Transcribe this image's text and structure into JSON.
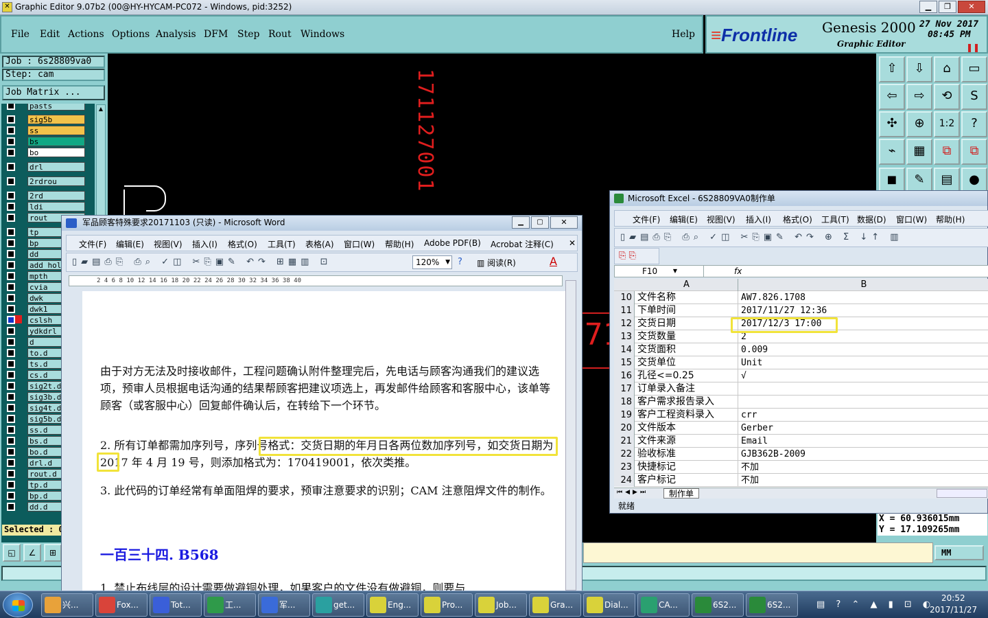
{
  "app": {
    "title": "Graphic Editor 9.07b2 (00@HY-HYCAM-PC072 - Windows, pid:3252)"
  },
  "menu": [
    "File",
    "Edit",
    "Actions",
    "Options",
    "Analysis",
    "DFM",
    "Step",
    "Rout",
    "Windows"
  ],
  "help_label": "Help",
  "brand": {
    "logo": "Frontline",
    "product": "Genesis 2000",
    "subtitle": "Graphic Editor",
    "date": "27 Nov 2017",
    "time": "08:45 PM"
  },
  "job": {
    "job_label": "Job  : 6s28809va0",
    "step_label": "Step: cam",
    "matrix_button": "Job Matrix ..."
  },
  "layers": [
    {
      "name": "pasts",
      "color": "#a8dcdc"
    },
    {
      "name": "sig5b",
      "color": "#f2c24a"
    },
    {
      "name": "ss",
      "color": "#f2c24a"
    },
    {
      "name": "bs",
      "color": "#11a884"
    },
    {
      "name": "bo",
      "color": "#ffffff"
    },
    {
      "name": "drl",
      "color": "#a8dcdc"
    },
    {
      "name": "2rdrou",
      "color": "#a8dcdc"
    },
    {
      "name": "2rd",
      "color": "#a8dcdc"
    },
    {
      "name": "ldi",
      "color": "#a8dcdc"
    },
    {
      "name": "rout",
      "color": "#a8dcdc"
    },
    {
      "name": "tp",
      "color": "#a8dcdc"
    },
    {
      "name": "bp",
      "color": "#a8dcdc"
    },
    {
      "name": "dd",
      "color": "#a8dcdc"
    },
    {
      "name": "add_hol",
      "color": "#a8dcdc"
    },
    {
      "name": "mpth",
      "color": "#a8dcdc"
    },
    {
      "name": "cvia",
      "color": "#a8dcdc"
    },
    {
      "name": "dwk",
      "color": "#a8dcdc"
    },
    {
      "name": "dwk1",
      "color": "#a8dcdc"
    },
    {
      "name": "cslsh",
      "color": "#a8dcdc"
    },
    {
      "name": "ydkdrl",
      "color": "#a8dcdc"
    },
    {
      "name": "d",
      "color": "#a8dcdc"
    },
    {
      "name": "to.d",
      "color": "#a8dcdc"
    },
    {
      "name": "ts.d",
      "color": "#a8dcdc"
    },
    {
      "name": "cs.d",
      "color": "#a8dcdc"
    },
    {
      "name": "sig2t.d",
      "color": "#a8dcdc"
    },
    {
      "name": "sig3b.d",
      "color": "#a8dcdc"
    },
    {
      "name": "sig4t.d",
      "color": "#a8dcdc"
    },
    {
      "name": "sig5b.d",
      "color": "#a8dcdc"
    },
    {
      "name": "ss.d",
      "color": "#a8dcdc"
    },
    {
      "name": "bs.d",
      "color": "#a8dcdc"
    },
    {
      "name": "bo.d",
      "color": "#a8dcdc"
    },
    {
      "name": "drl.d",
      "color": "#a8dcdc"
    },
    {
      "name": "rout.d",
      "color": "#a8dcdc"
    },
    {
      "name": "tp.d",
      "color": "#a8dcdc"
    },
    {
      "name": "bp.d",
      "color": "#a8dcdc"
    },
    {
      "name": "dd.d",
      "color": "#a8dcdc"
    }
  ],
  "selected_label": "Selected : 0",
  "canvas": {
    "vertical_text": "171127001",
    "red_fragment": "71"
  },
  "coords": {
    "x": "X  = 60.936015mm",
    "y": "Y  = 17.109265mm"
  },
  "unit": "MM",
  "word": {
    "title": "军品顾客特殊要求20171103 (只读) - Microsoft Word",
    "menu": [
      "文件(F)",
      "编辑(E)",
      "视图(V)",
      "插入(I)",
      "格式(O)",
      "工具(T)",
      "表格(A)",
      "窗口(W)",
      "帮助(H)",
      "Adobe PDF(B)",
      "Acrobat 注释(C)"
    ],
    "zoom": "120%",
    "read_label": "阅读(R)",
    "ruler": "2  4  6  8  10  12  14  16  18  20  22  24  26  28  30  32  34  36  38  40",
    "para1": "由于对方无法及时接收邮件，工程问题确认附件整理完后，先电话与顾客沟通我们的建议选项，预审人员根据电话沟通的结果帮顾客把建议项选上，再发邮件给顾客和客服中心，该单等顾客（或客服中心）回复邮件确认后，在转给下一个环节。",
    "para2": "2.  所有订单都需加序列号，序列号格式：交货日期的年月日各两位数加序列号，如交货日期为 2017 年 4 月 19 号，则添加格式为：170419001，依次类推。",
    "para3": "3.  此代码的订单经常有单面阻焊的要求，预审注意要求的识别；CAM 注意阻焊文件的制作。",
    "heading": "一百三十四. B568",
    "para4": "1.  禁止布线层的设计需要做避铜处理，如果客户的文件没有做避铜，则要与"
  },
  "excel": {
    "title": "Microsoft Excel - 6S28809VA0制作单",
    "menu": [
      "文件(F)",
      "编辑(E)",
      "视图(V)",
      "插入(I)",
      "格式(O)",
      "工具(T)",
      "数据(D)",
      "窗口(W)",
      "帮助(H)"
    ],
    "name_box": "F10",
    "col_a": "A",
    "col_b": "B",
    "rows": [
      {
        "n": "10",
        "a": "文件名称",
        "b": "AW7.826.1708"
      },
      {
        "n": "11",
        "a": "下单时间",
        "b": "2017/11/27 12:36"
      },
      {
        "n": "12",
        "a": "交货日期",
        "b": "2017/12/3 17:00"
      },
      {
        "n": "13",
        "a": "交货数量",
        "b": "2"
      },
      {
        "n": "14",
        "a": "交货面积",
        "b": "0.009"
      },
      {
        "n": "15",
        "a": "交货单位",
        "b": "Unit"
      },
      {
        "n": "16",
        "a": "孔径<=0.25",
        "b": "√"
      },
      {
        "n": "17",
        "a": "订单录入备注",
        "b": ""
      },
      {
        "n": "18",
        "a": "客户需求报告录入",
        "b": ""
      },
      {
        "n": "19",
        "a": "客户工程资料录入",
        "b": "crr"
      },
      {
        "n": "20",
        "a": "文件版本",
        "b": "Gerber"
      },
      {
        "n": "21",
        "a": "文件来源",
        "b": "Email"
      },
      {
        "n": "22",
        "a": "验收标准",
        "b": "GJB362B-2009"
      },
      {
        "n": "23",
        "a": "快捷标记",
        "b": "不加"
      },
      {
        "n": "24",
        "a": "客户标记",
        "b": "不加"
      }
    ],
    "sheet_tab": "制作单",
    "status": "就绪"
  },
  "taskbar": {
    "items": [
      {
        "label": "兴...",
        "color": "#e8a23a"
      },
      {
        "label": "Fox...",
        "color": "#d9443a"
      },
      {
        "label": "Tot...",
        "color": "#3a5fd9"
      },
      {
        "label": "工...",
        "color": "#2f9a4a"
      },
      {
        "label": "军...",
        "color": "#3a6bd9"
      },
      {
        "label": "get...",
        "color": "#2aa0a0"
      },
      {
        "label": "Eng...",
        "color": "#d9d23a"
      },
      {
        "label": "Pro...",
        "color": "#d9d23a"
      },
      {
        "label": "Job...",
        "color": "#d9d23a"
      },
      {
        "label": "Gra...",
        "color": "#d9d23a"
      },
      {
        "label": "Dial...",
        "color": "#d9d23a"
      },
      {
        "label": "CA...",
        "color": "#2aa070"
      },
      {
        "label": "6S2...",
        "color": "#2a8a3a"
      },
      {
        "label": "6S2...",
        "color": "#2a8a3a"
      }
    ],
    "time": "20:52",
    "date": "2017/11/27"
  }
}
